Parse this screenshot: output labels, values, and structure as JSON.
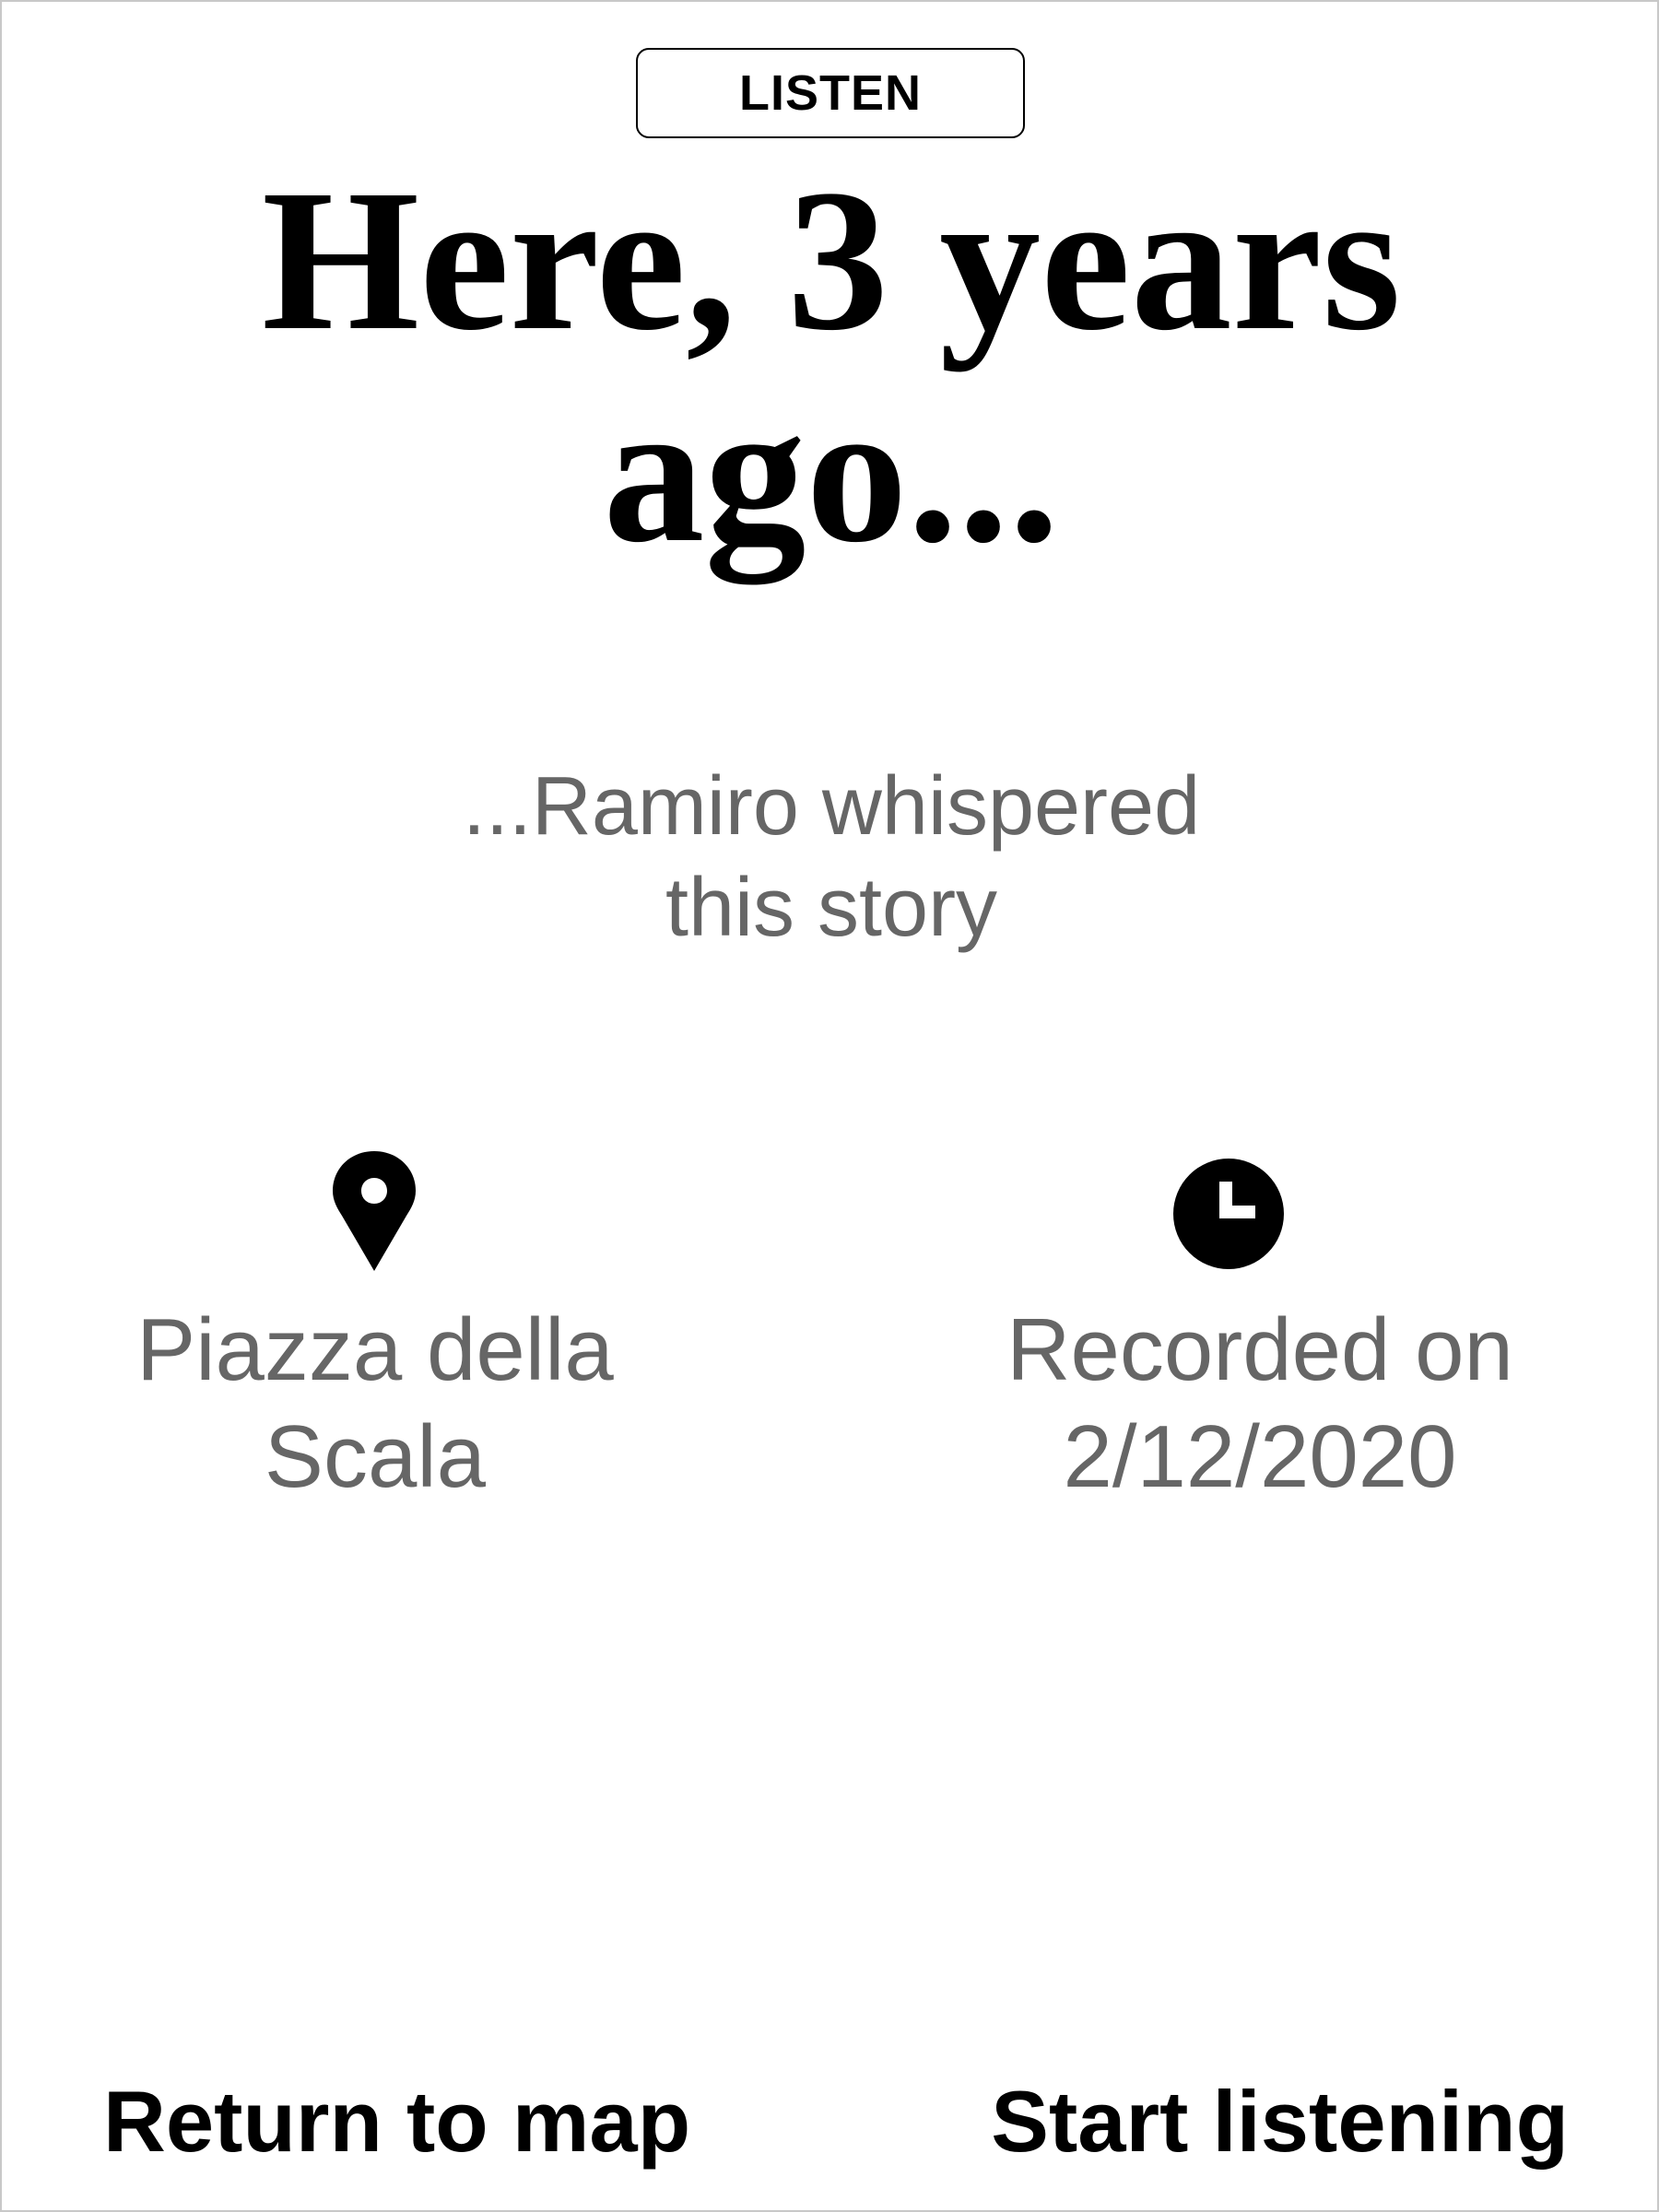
{
  "header": {
    "mode_label": "LISTEN"
  },
  "story": {
    "headline_line1": "Here, 3 years",
    "headline_line2": "ago...",
    "attribution_line1": "...Ramiro whispered",
    "attribution_line2": "this story"
  },
  "info": {
    "location_icon": "map-pin-icon",
    "location_line1": "Piazza della",
    "location_line2": "Scala",
    "date_icon": "clock-icon",
    "date_line1": "Recorded on",
    "date_line2": "2/12/2020"
  },
  "actions": {
    "return_label": "Return to map",
    "start_label": "Start listening"
  },
  "colors": {
    "text_primary": "#000000",
    "text_secondary": "#666666",
    "background": "#ffffff"
  }
}
